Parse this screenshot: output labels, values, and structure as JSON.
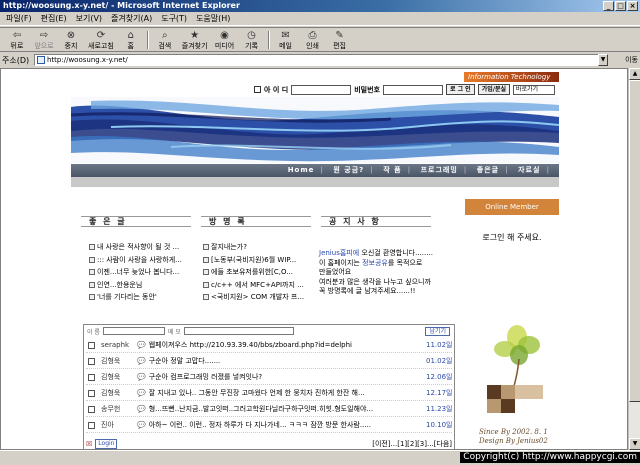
{
  "window": {
    "title": "http://woosung.x-y.net/ - Microsoft Internet Explorer",
    "buttons": [
      "_",
      "□",
      "×"
    ]
  },
  "menu": [
    "파일(F)",
    "편집(E)",
    "보기(V)",
    "즐겨찾기(A)",
    "도구(T)",
    "도움말(H)"
  ],
  "toolbar": [
    {
      "label": "뒤로",
      "icon": "back-arrow-icon",
      "glyph": "⇦"
    },
    {
      "label": "앞으로",
      "icon": "forward-arrow-icon",
      "glyph": "⇨"
    },
    {
      "label": "중지",
      "icon": "stop-icon",
      "glyph": "⊗"
    },
    {
      "label": "새로고침",
      "icon": "refresh-icon",
      "glyph": "⟳"
    },
    {
      "label": "홈",
      "icon": "home-icon",
      "glyph": "⌂"
    },
    {
      "label": "검색",
      "icon": "search-icon",
      "glyph": "⌕"
    },
    {
      "label": "즐겨찾기",
      "icon": "favorites-icon",
      "glyph": "★"
    },
    {
      "label": "미디어",
      "icon": "media-icon",
      "glyph": "◉"
    },
    {
      "label": "기록",
      "icon": "history-icon",
      "glyph": "◷"
    },
    {
      "label": "메일",
      "icon": "mail-icon",
      "glyph": "✉"
    },
    {
      "label": "인쇄",
      "icon": "print-icon",
      "glyph": "⎙"
    },
    {
      "label": "편집",
      "icon": "edit-icon",
      "glyph": "✎"
    }
  ],
  "address": {
    "label": "주소(D)",
    "url": "http://woosung.x-y.net/",
    "go": "이동"
  },
  "site": {
    "info_tech": "Information Technology",
    "login": {
      "id_label": "아 이 디",
      "pw_label": "비밀번호",
      "login_btn": "로 그 인",
      "join_btn": "가입/분실",
      "select": "바로가기"
    },
    "nav": [
      "Home",
      "뭔 궁금?",
      "작 품",
      "프로그래밍",
      "좋은글",
      "자료실"
    ],
    "tabs": [
      "좋 은 글",
      "방 명 록",
      "공 지 사 항"
    ],
    "good_posts": [
      "내 사랑은 적사향이 될 것 ...",
      "::: 사람이 사랑을 사랑하게...",
      "이젠...너무 늦었나 봅니다...",
      "인연...한용운님",
      "'너를 기다리는 동안'"
    ],
    "guest_posts": [
      "잘지내는가?",
      "[노동부(국비지원)6월 WIP...",
      "에들 초보유저를위한[C,O...",
      "c/c++ 에서 MFC+API까지 ...",
      "<국비지원> COM 개발자 프..."
    ],
    "notice": {
      "highlight": "Jenius홈피에",
      "line1": " 오신걸 환영합니다........",
      "line2a": "이 홈페이지는 ",
      "line2_link": "정보공유",
      "line2b": "를 목적으로",
      "line3": "만들었어요",
      "line4": "여러분과 많은 생각을 나누고 싶으니까",
      "line5": "꼭 방명록에 글 남겨주세요......!!"
    },
    "member": {
      "title": "Online Member",
      "login_msg": "로그인 해 주세요."
    },
    "since": "Since By 2002. 8. 1",
    "design": "Design By Jenius02",
    "guestbook": {
      "name_label": "이 름",
      "memo_label": "메 모",
      "write_btn": "남기기",
      "entries": [
        {
          "name": "seraphk",
          "msg": "웹페이져우스 http://210.93.39.40/bbs/zboard.php?id=delphi",
          "date": "11.02일"
        },
        {
          "name": "김형욱",
          "msg": "구순아 정말 고맙다.......",
          "date": "01.02일"
        },
        {
          "name": "김형욱",
          "msg": "구순아 컴프로그래밍 러졌를 넣켜잇나?",
          "date": "12.06일"
        },
        {
          "name": "김형욱",
          "msg": "잘 지내고 있나.. 그동안 무진장 고마웠다 언제 한 뭉치자 진하게 한잔 해...",
          "date": "12.17일"
        },
        {
          "name": "송무헌",
          "msg": "형...뜨뻔..난지금..발고잇떠..그러고학원다닐라구하구잇떠.히힛.형도일해야...",
          "date": "11.23일"
        },
        {
          "name": "진아",
          "msg": "아하~ 이런.. 이런.. 정자 하루가 다 지나가네... ㅋㅋㅋ 잠깐 방문 한사람.....",
          "date": "10.10일"
        }
      ],
      "login_btn": "Login",
      "pagination": "[이전]...[1][2][3]...[다음]"
    }
  },
  "copyright": "Copyright(c) http://www.happycgi.com"
}
